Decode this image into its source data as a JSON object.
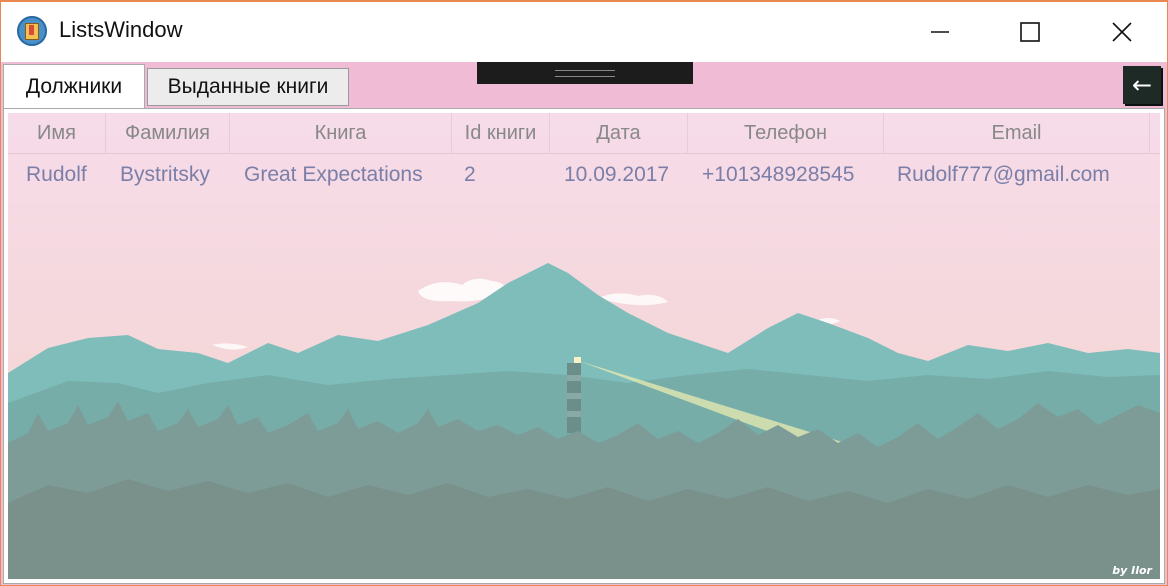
{
  "window": {
    "title": "ListsWindow",
    "controls": {
      "minimize": "minimize",
      "maximize": "maximize",
      "close": "close"
    }
  },
  "tabs": [
    {
      "label": "Должники",
      "active": true
    },
    {
      "label": "Выданные книги",
      "active": false
    }
  ],
  "back_button": {
    "label": "←"
  },
  "table": {
    "headers": [
      "Имя",
      "Фамилия",
      "Книга",
      "Id книги",
      "Дата",
      "Телефон",
      "Email"
    ],
    "rows": [
      [
        "Rudolf",
        "Bystritsky",
        "Great Expectations",
        "2",
        "10.09.2017",
        "+101348928545",
        "Rudolf777@gmail.com"
      ]
    ]
  },
  "background": {
    "watermark": "by Ilor"
  },
  "colors": {
    "accent_border": "#e8874f",
    "tab_strip": "#efbbd5",
    "cell_text": "#7b7fa8",
    "header_text": "#888888"
  }
}
